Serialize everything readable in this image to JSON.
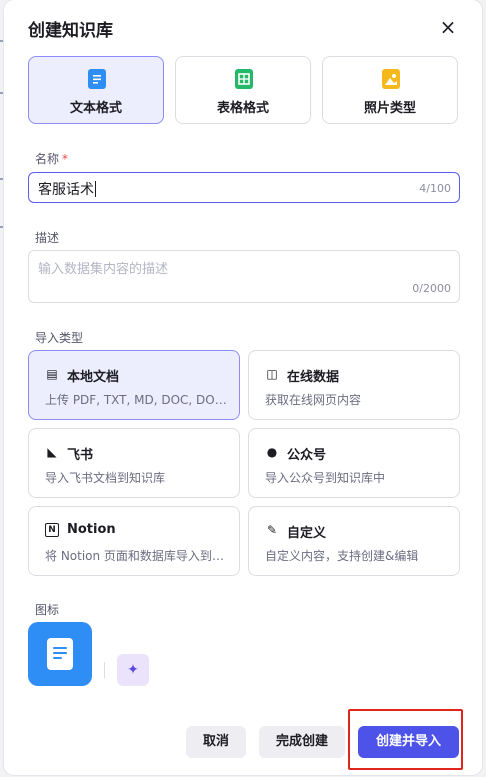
{
  "modal": {
    "title": "创建知识库",
    "close_icon": "×"
  },
  "formats": [
    {
      "label": "文本格式",
      "icon": "document-icon",
      "color": "#2f8ef5",
      "selected": true
    },
    {
      "label": "表格格式",
      "icon": "table-icon",
      "color": "#24b868",
      "selected": false
    },
    {
      "label": "照片类型",
      "icon": "image-icon",
      "color": "#f5b81d",
      "selected": false
    }
  ],
  "name_field": {
    "label": "名称",
    "required_mark": "*",
    "value": "客服话术",
    "counter": "4/100"
  },
  "desc_field": {
    "label": "描述",
    "placeholder": "输入数据集内容的描述",
    "counter": "0/2000"
  },
  "import_type": {
    "label": "导入类型",
    "options": [
      {
        "title": "本地文档",
        "desc": "上传 PDF, TXT, MD, DOC, DOCX 格式的本地文件",
        "icon": "file-text-icon",
        "glyph": "▤",
        "selected": true
      },
      {
        "title": "在线数据",
        "desc": "获取在线网页内容",
        "icon": "web-page-icon",
        "glyph": "◫",
        "selected": false
      },
      {
        "title": "飞书",
        "desc": "导入飞书文档到知识库",
        "icon": "feishu-icon",
        "glyph": "◣",
        "selected": false
      },
      {
        "title": "公众号",
        "desc": "导入公众号到知识库中",
        "icon": "wechat-icon",
        "glyph": "●",
        "selected": false
      },
      {
        "title": "Notion",
        "desc": "将 Notion 页面和数据库导入到知识库中",
        "icon": "notion-icon",
        "glyph": "N",
        "selected": false
      },
      {
        "title": "自定义",
        "desc": "自定义内容，支持创建&编辑",
        "icon": "custom-edit-icon",
        "glyph": "✎",
        "selected": false
      }
    ]
  },
  "icon_section": {
    "label": "图标",
    "avatar_color": "#2f8ef5",
    "magic_icon": "✦"
  },
  "footer": {
    "cancel": "取消",
    "finish_create": "完成创建",
    "create_import": "创建并导入",
    "primary_color": "#4d53e8"
  }
}
